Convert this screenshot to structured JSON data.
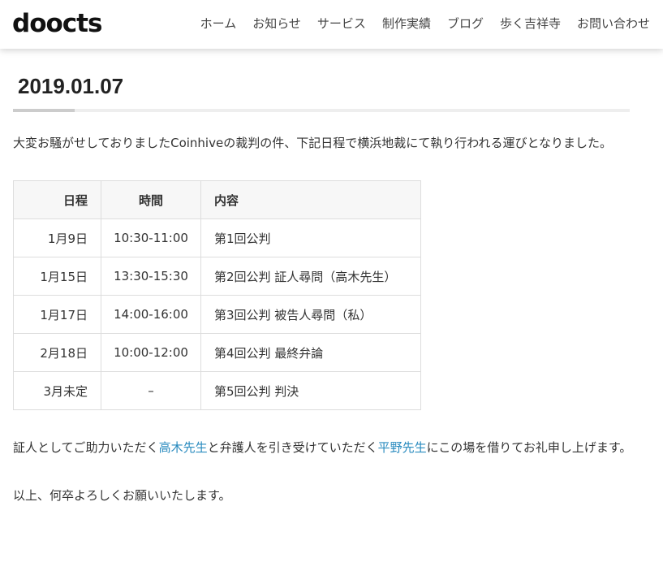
{
  "header": {
    "logo": "doocts",
    "nav": [
      "ホーム",
      "お知らせ",
      "サービス",
      "制作実績",
      "ブログ",
      "歩く吉祥寺",
      "お問い合わせ"
    ]
  },
  "post": {
    "date_title": "2019.01.07",
    "intro": "大変お騒がせしておりましたCoinhiveの裁判の件、下記日程で横浜地裁にて執り行われる運びとなりました。",
    "table": {
      "headers": [
        "日程",
        "時間",
        "内容"
      ],
      "rows": [
        [
          "1月9日",
          "10:30-11:00",
          "第1回公判"
        ],
        [
          "1月15日",
          "13:30-15:30",
          "第2回公判 証人尋問（高木先生）"
        ],
        [
          "1月17日",
          "14:00-16:00",
          "第3回公判 被告人尋問（私）"
        ],
        [
          "2月18日",
          "10:00-12:00",
          "第4回公判 最終弁論"
        ],
        [
          "3月未定",
          "–",
          "第5回公判 判決"
        ]
      ]
    },
    "thanks": {
      "part1": "証人としてご助力いただく",
      "link1": "高木先生",
      "part2": "と弁護人を引き受けていただく",
      "link2": "平野先生",
      "part3": "にこの場を借りてお礼申し上げます。"
    },
    "closing": "以上、何卒よろしくお願いいたします。"
  },
  "colors": {
    "link": "#2a8bbf",
    "text": "#333333",
    "accent_rule": "#cccccc"
  }
}
